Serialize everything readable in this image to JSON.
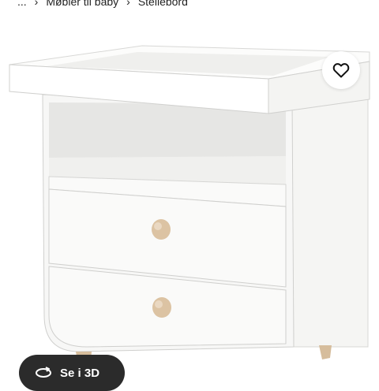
{
  "breadcrumb": {
    "ellipsis": "...",
    "items": [
      "Møbler til baby",
      "Stellebord"
    ]
  },
  "view3d": {
    "label": "Se i 3D"
  },
  "icons": {
    "separator": "chevron-right-icon",
    "favorite": "heart-icon",
    "view3d": "rotate-3d-icon"
  },
  "colors": {
    "furniture_white": "#f4f4f2",
    "knob_wood": "#dcc3a3",
    "button_dark": "#2b2b2b"
  }
}
